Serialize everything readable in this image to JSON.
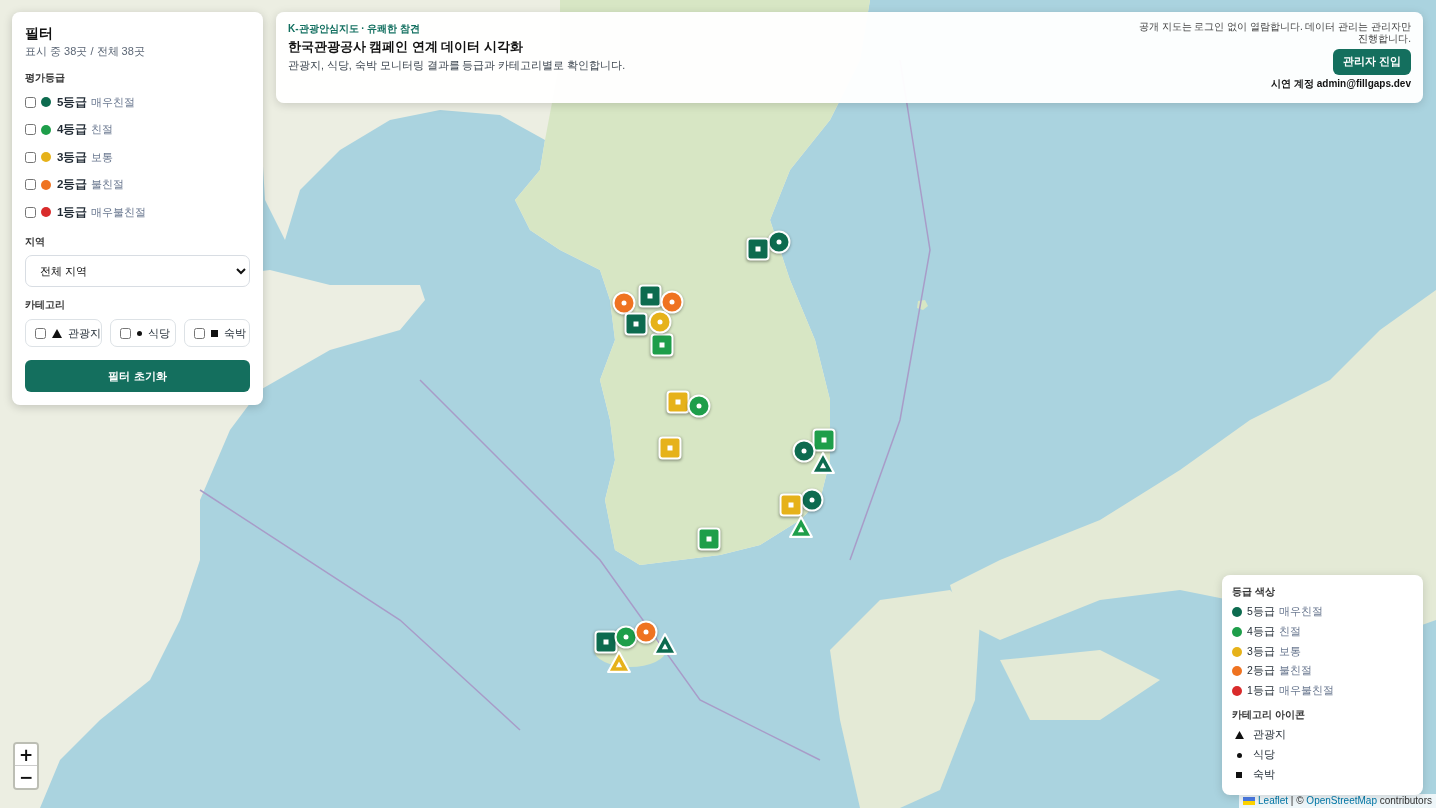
{
  "filter_panel": {
    "title": "필터",
    "count": "표시 중 38곳 / 전체 38곳",
    "grade_heading": "평가등급",
    "grades": [
      {
        "grade": "5등급",
        "label": "매우친절",
        "color": "#0d6b4f",
        "checked": false
      },
      {
        "grade": "4등급",
        "label": "친절",
        "color": "#1e9e4a",
        "checked": false
      },
      {
        "grade": "3등급",
        "label": "보통",
        "color": "#e6b21a",
        "checked": false
      },
      {
        "grade": "2등급",
        "label": "불친절",
        "color": "#ef7321",
        "checked": false
      },
      {
        "grade": "1등급",
        "label": "매우불친절",
        "color": "#d92b2b",
        "checked": false
      }
    ],
    "region_heading": "지역",
    "region_select": {
      "value": "전체 지역"
    },
    "category_heading": "카테고리",
    "categories": [
      {
        "kind": "attraction",
        "label": "관광지",
        "checked": false
      },
      {
        "kind": "restaurant",
        "label": "식당",
        "checked": false
      },
      {
        "kind": "lodging",
        "label": "숙박",
        "checked": false
      }
    ],
    "reset_button": "필터 초기화"
  },
  "header": {
    "eyebrow": "K-관광안심지도 · 유쾌한 참견",
    "title": "한국관광공사 캠페인 연계 데이터 시각화",
    "description": "관광지, 식당, 숙박 모니터링 결과를 등급과 카테고리별로 확인합니다.",
    "note": "공개 지도는 로그인 없이 열람합니다. 데이터 관리는 관리자만 진행합니다.",
    "admin_button": "관리자 진입",
    "demo_account": "시연 계정 admin@fillgaps.dev"
  },
  "legend": {
    "grade_heading": "등급 색상",
    "grades": [
      {
        "grade": "5등급",
        "label": "매우친절",
        "color": "#0d6b4f"
      },
      {
        "grade": "4등급",
        "label": "친절",
        "color": "#1e9e4a"
      },
      {
        "grade": "3등급",
        "label": "보통",
        "color": "#e6b21a"
      },
      {
        "grade": "2등급",
        "label": "불친절",
        "color": "#ef7321"
      },
      {
        "grade": "1등급",
        "label": "매우불친절",
        "color": "#d92b2b"
      }
    ],
    "category_heading": "카테고리 아이콘",
    "categories": [
      {
        "kind": "attraction",
        "label": "관광지"
      },
      {
        "kind": "restaurant",
        "label": "식당"
      },
      {
        "kind": "lodging",
        "label": "숙박"
      }
    ]
  },
  "map": {
    "markers": [
      {
        "kind": "restaurant",
        "color": "#0d6b4f"
      },
      {
        "kind": "lodging",
        "color": "#0d6b4f"
      },
      {
        "kind": "lodging",
        "color": "#0d6b4f"
      },
      {
        "kind": "restaurant",
        "color": "#ef7321"
      },
      {
        "kind": "lodging",
        "color": "#0d6b4f"
      },
      {
        "kind": "restaurant",
        "color": "#ef7321"
      },
      {
        "kind": "lodging",
        "color": "#1e9e4a"
      },
      {
        "kind": "restaurant",
        "color": "#e6b21a"
      },
      {
        "kind": "lodging",
        "color": "#e6b21a"
      },
      {
        "kind": "restaurant",
        "color": "#1e9e4a"
      },
      {
        "kind": "lodging",
        "color": "#e6b21a"
      },
      {
        "kind": "lodging",
        "color": "#1e9e4a"
      },
      {
        "kind": "restaurant",
        "color": "#0d6b4f"
      },
      {
        "kind": "attraction",
        "color": "#0d6b4f"
      },
      {
        "kind": "restaurant",
        "color": "#0d6b4f"
      },
      {
        "kind": "lodging",
        "color": "#e6b21a"
      },
      {
        "kind": "attraction",
        "color": "#1e9e4a"
      },
      {
        "kind": "lodging",
        "color": "#1e9e4a"
      },
      {
        "kind": "lodging",
        "color": "#0d6b4f"
      },
      {
        "kind": "restaurant",
        "color": "#1e9e4a"
      },
      {
        "kind": "restaurant",
        "color": "#ef7321"
      },
      {
        "kind": "attraction",
        "color": "#0d6b4f"
      },
      {
        "kind": "attraction",
        "color": "#e6b21a"
      }
    ],
    "zoom_in": "+",
    "zoom_out": "−",
    "attribution": {
      "leaflet_link": "Leaflet",
      "separator": "| ©",
      "osm_link": "OpenStreetMap",
      "suffix": "contributors"
    }
  }
}
